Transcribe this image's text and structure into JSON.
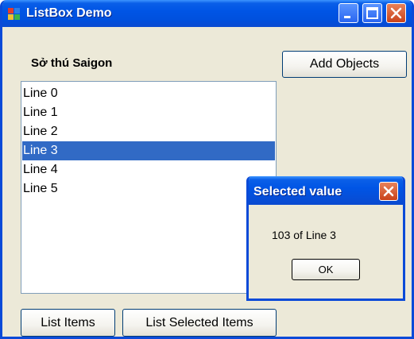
{
  "window": {
    "title": "ListBox Demo",
    "minimize_icon": "minimize-icon",
    "maximize_icon": "maximize-icon",
    "close_icon": "close-icon"
  },
  "form": {
    "label": "Sở thú Saigon",
    "add_objects_label": "Add Objects",
    "list_items_label": "List Items",
    "list_selected_items_label": "List Selected Items"
  },
  "listbox": {
    "items": [
      "Line 0",
      "Line 1",
      "Line 2",
      "Line 3",
      "Line 4",
      "Line 5"
    ],
    "selected": "Line 3"
  },
  "dialog": {
    "title": "Selected value",
    "message": "103 of Line 3",
    "ok_label": "OK"
  },
  "colors": {
    "titlebar": "#0055e5",
    "selection": "#316ac5",
    "window_bg": "#ece9d8"
  }
}
